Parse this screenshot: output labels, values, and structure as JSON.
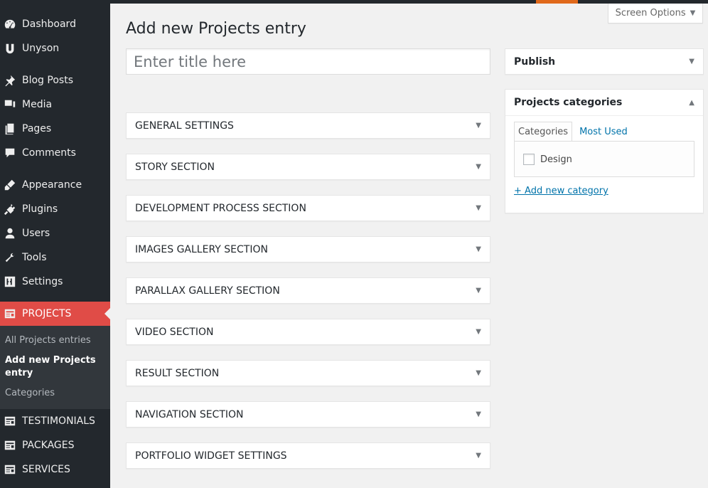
{
  "sidebar": {
    "items": [
      {
        "label": "Dashboard",
        "icon": "dashboard-icon"
      },
      {
        "label": "Unyson",
        "icon": "unyson-icon"
      },
      {
        "label": "Blog Posts",
        "icon": "pin-icon"
      },
      {
        "label": "Media",
        "icon": "media-icon"
      },
      {
        "label": "Pages",
        "icon": "pages-icon"
      },
      {
        "label": "Comments",
        "icon": "comments-icon"
      },
      {
        "label": "Appearance",
        "icon": "appearance-icon"
      },
      {
        "label": "Plugins",
        "icon": "plugins-icon"
      },
      {
        "label": "Users",
        "icon": "users-icon"
      },
      {
        "label": "Tools",
        "icon": "tools-icon"
      },
      {
        "label": "Settings",
        "icon": "settings-icon"
      },
      {
        "label": "PROJECTS",
        "icon": "projects-icon"
      },
      {
        "label": "TESTIMONIALS",
        "icon": "testimonials-icon"
      },
      {
        "label": "PACKAGES",
        "icon": "packages-icon"
      },
      {
        "label": "SERVICES",
        "icon": "services-icon"
      }
    ],
    "submenu": [
      {
        "label": "All Projects entries"
      },
      {
        "label": "Add new Projects entry"
      },
      {
        "label": "Categories"
      }
    ]
  },
  "colors": {
    "sidebar_bg": "#23282d",
    "active_menu": "#e04c47",
    "accent": "#e0691b",
    "link": "#0073aa"
  },
  "header": {
    "screen_options": "Screen Options",
    "title": "Add new Projects entry"
  },
  "title_input": {
    "placeholder": "Enter title here",
    "value": ""
  },
  "sections": [
    {
      "label": "GENERAL SETTINGS"
    },
    {
      "label": "STORY SECTION"
    },
    {
      "label": "DEVELOPMENT PROCESS SECTION"
    },
    {
      "label": "IMAGES GALLERY SECTION"
    },
    {
      "label": "PARALLAX GALLERY SECTION"
    },
    {
      "label": "VIDEO SECTION"
    },
    {
      "label": "RESULT SECTION"
    },
    {
      "label": "NAVIGATION SECTION"
    },
    {
      "label": "PORTFOLIO WIDGET SETTINGS"
    }
  ],
  "publish": {
    "label": "Publish"
  },
  "categories_box": {
    "title": "Projects categories",
    "tabs": [
      "Categories",
      "Most Used"
    ],
    "items": [
      {
        "label": "Design",
        "checked": false
      }
    ],
    "add_link": "+ Add new category"
  }
}
